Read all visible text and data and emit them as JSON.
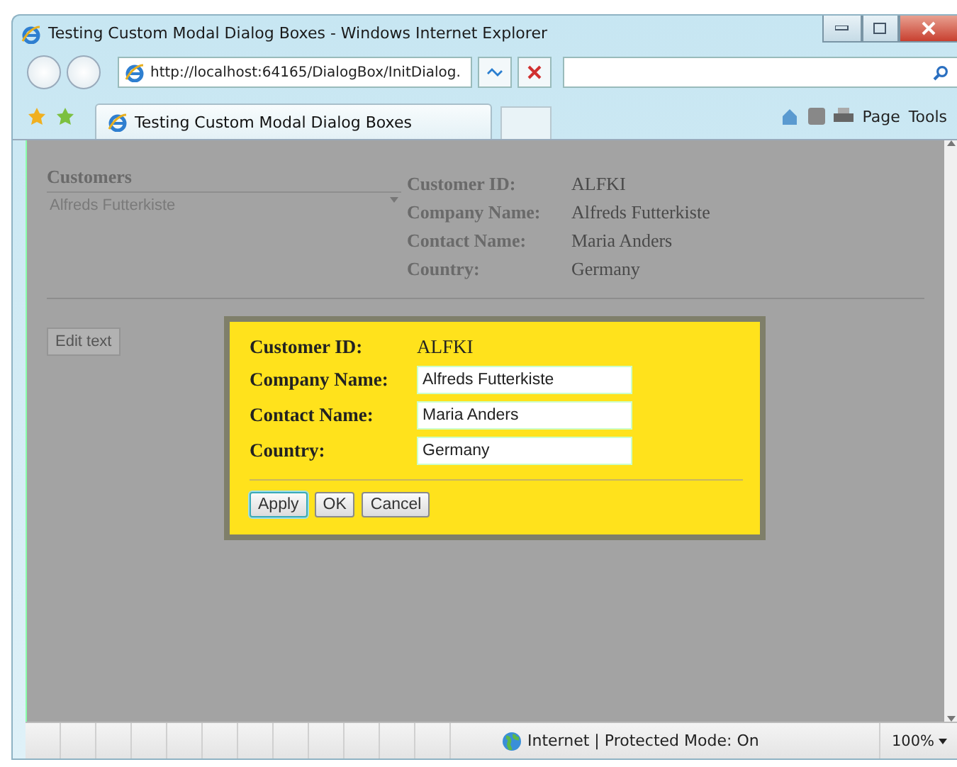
{
  "window": {
    "title": "Testing Custom Modal Dialog Boxes - Windows Internet Explorer"
  },
  "address_bar": {
    "url": "http://localhost:64165/DialogBox/InitDialog."
  },
  "tab": {
    "title": "Testing Custom Modal Dialog Boxes"
  },
  "command_bar": [
    "Page",
    "Tools"
  ],
  "page": {
    "customers_label": "Customers",
    "customer_select": "Alfreds Futterkiste",
    "edit_button": "Edit text",
    "details": [
      {
        "label": "Customer ID:",
        "value": "ALFKI"
      },
      {
        "label": "Company Name:",
        "value": "Alfreds Futterkiste"
      },
      {
        "label": "Contact Name:",
        "value": "Maria Anders"
      },
      {
        "label": "Country:",
        "value": "Germany"
      }
    ]
  },
  "dialog": {
    "fields": [
      {
        "label": "Customer ID:",
        "value": "ALFKI",
        "kind": "text"
      },
      {
        "label": "Company Name:",
        "value": "Alfreds Futterkiste",
        "kind": "input"
      },
      {
        "label": "Contact Name:",
        "value": "Maria Anders",
        "kind": "input"
      },
      {
        "label": "Country:",
        "value": "Germany",
        "kind": "input"
      }
    ],
    "buttons": [
      {
        "label": "Apply",
        "focused": true
      },
      {
        "label": "OK",
        "focused": false
      },
      {
        "label": "Cancel",
        "focused": false
      }
    ]
  },
  "status_bar": {
    "zone": "Internet | Protected Mode: On",
    "zoom": "100%"
  }
}
